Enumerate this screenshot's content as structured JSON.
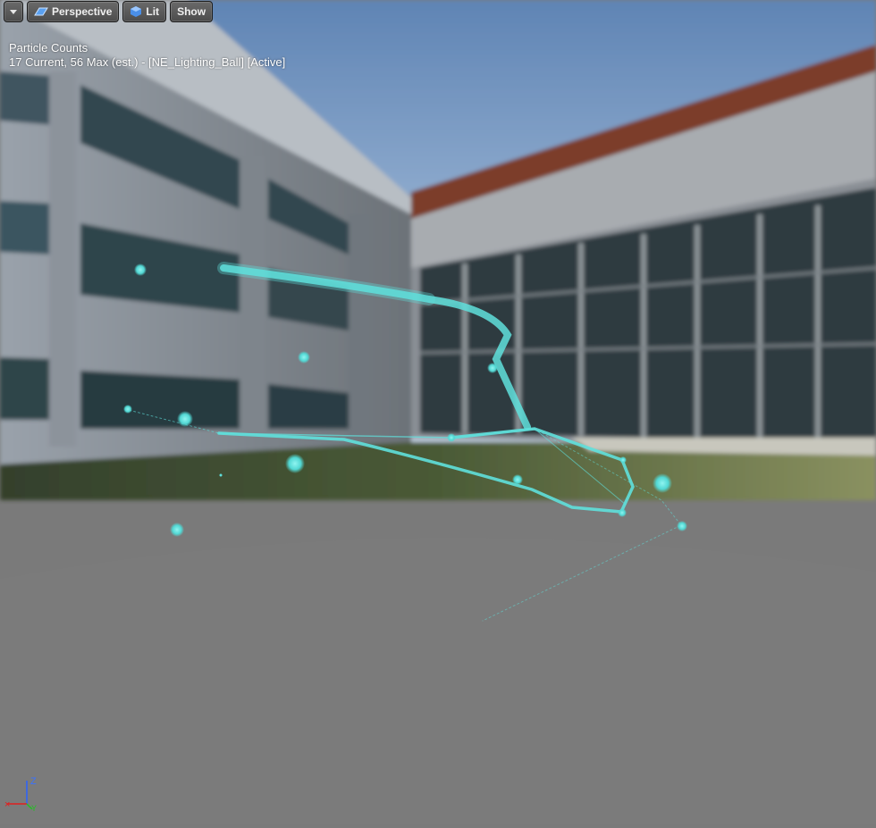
{
  "toolbar": {
    "menu_icon": "chevron-down-icon",
    "perspective_label": "Perspective",
    "perspective_icon": "perspective-plane-icon",
    "lit_label": "Lit",
    "lit_icon": "lit-sphere-icon",
    "show_label": "Show"
  },
  "stats": {
    "title": "Particle Counts",
    "detail": "17 Current, 56 Max (est.) - [NE_Lighting_Ball] [Active]"
  },
  "axis_gizmo": {
    "z_label": "Z",
    "x_color": "#e02020",
    "y_color": "#20c020",
    "z_color": "#2060ff"
  },
  "colors": {
    "particle": "#5fe0dc",
    "floor": "#7a7a7a",
    "sky": "#8fb0d6"
  }
}
